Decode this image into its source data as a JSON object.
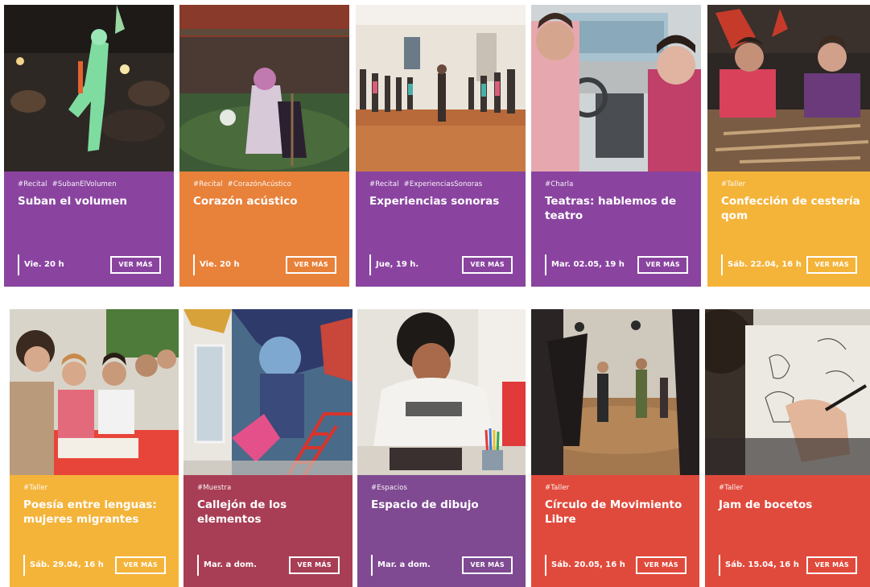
{
  "colors": {
    "purple": "#8a44a0",
    "orange": "#e8813a",
    "yellow": "#f4b43a",
    "red": "#e04a3c",
    "maroon": "#a83e55",
    "violet": "#7f4a92"
  },
  "cards": [
    {
      "tags": [
        "#Recital",
        "#SubanElVolumen"
      ],
      "title": "Suban el volumen",
      "date": "Vie. 20 h",
      "button": "VER MÁS",
      "color": "#8a44a0",
      "photo": "stage-performer-photo"
    },
    {
      "tags": [
        "#Recital",
        "#CorazónAcústico"
      ],
      "title": "Corazón acústico",
      "date": "Vie. 20 h",
      "button": "VER MÁS",
      "color": "#e8813a",
      "photo": "cello-concert-photo"
    },
    {
      "tags": [
        "#Recital",
        "#ExperienciasSonoras"
      ],
      "title": "Experiencias sonoras",
      "date": "Jue, 19 h.",
      "button": "VER MÁS",
      "color": "#8a44a0",
      "photo": "circle-dance-photo"
    },
    {
      "tags": [
        "#Charla"
      ],
      "title": "Teatras: hablemos de teatro",
      "date": "Mar. 02.05, 19 h",
      "button": "VER MÁS",
      "color": "#8a44a0",
      "photo": "car-interior-photo"
    },
    {
      "tags": [
        "#Taller"
      ],
      "title": "Confección de cestería qom",
      "date": "Sáb. 22.04, 16 h",
      "button": "VER MÁS",
      "color": "#f4b43a",
      "photo": "basket-weaving-photo"
    },
    {
      "tags": [
        "#Taller"
      ],
      "title": "Poesía entre lenguas: mujeres migrantes",
      "date": "Sáb. 29.04, 16 h",
      "button": "VER MÁS",
      "color": "#f4b43a",
      "photo": "poetry-workshop-photo"
    },
    {
      "tags": [
        "#Muestra"
      ],
      "title": "Callejón de los elementos",
      "date": "Mar. a dom.",
      "button": "VER MÁS",
      "color": "#a83e55",
      "photo": "graffiti-alley-photo"
    },
    {
      "tags": [
        "#Espacios"
      ],
      "title": "Espacio de dibujo",
      "date": "Mar. a dom.",
      "button": "VER MÁS",
      "color": "#7f4a92",
      "photo": "drawing-space-photo"
    },
    {
      "tags": [
        "#Taller"
      ],
      "title": "Círculo de Movimiento Libre",
      "date": "Sáb. 20.05, 16 h",
      "button": "VER MÁS",
      "color": "#e04a3c",
      "photo": "movement-dance-photo"
    },
    {
      "tags": [
        "#Taller"
      ],
      "title": "Jam de bocetos",
      "date": "Sáb. 15.04, 16 h",
      "button": "VER MÁS",
      "color": "#e04a3c",
      "photo": "sketch-jam-photo"
    }
  ]
}
